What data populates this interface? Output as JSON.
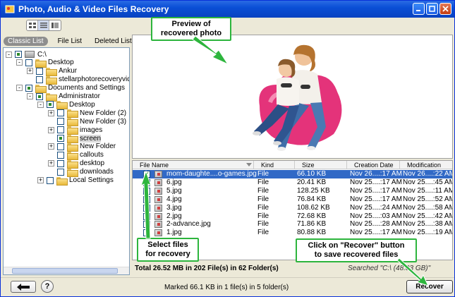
{
  "window": {
    "title": "Photo, Audio & Video Files Recovery",
    "controls": [
      "minimize-icon",
      "maximize-icon",
      "close-icon"
    ]
  },
  "tabs": [
    {
      "label": "Classic List",
      "active": true
    },
    {
      "label": "File List",
      "active": false
    },
    {
      "label": "Deleted List",
      "active": false
    }
  ],
  "tree": [
    {
      "label": "C:\\",
      "level": 0,
      "expander": "-",
      "check": "partial",
      "icon": "drive-icon"
    },
    {
      "label": "Desktop",
      "level": 1,
      "expander": "-",
      "check": "none",
      "icon": "folder-icon"
    },
    {
      "label": "Ankur",
      "level": 2,
      "expander": "+",
      "check": "none",
      "icon": "folder-icon"
    },
    {
      "label": "stellarphotorecoveryvideo",
      "level": 2,
      "expander": "",
      "check": "none",
      "icon": "folder-icon"
    },
    {
      "label": "Documents and Settings",
      "level": 1,
      "expander": "-",
      "check": "partial",
      "icon": "folder-icon"
    },
    {
      "label": "Administrator",
      "level": 2,
      "expander": "-",
      "check": "partial",
      "icon": "folder-icon"
    },
    {
      "label": "Desktop",
      "level": 3,
      "expander": "-",
      "check": "partial",
      "icon": "folder-icon"
    },
    {
      "label": "New Folder (2)",
      "level": 4,
      "expander": "+",
      "check": "none",
      "icon": "folder-icon"
    },
    {
      "label": "New Folder (3)",
      "level": 4,
      "expander": "",
      "check": "none",
      "icon": "folder-icon"
    },
    {
      "label": "images",
      "level": 4,
      "expander": "+",
      "check": "none",
      "icon": "folder-icon"
    },
    {
      "label": "screen",
      "level": 4,
      "expander": "",
      "check": "partial",
      "icon": "folder-icon",
      "selected": true
    },
    {
      "label": "New Folder",
      "level": 4,
      "expander": "+",
      "check": "none",
      "icon": "folder-icon"
    },
    {
      "label": "callouts",
      "level": 4,
      "expander": "",
      "check": "none",
      "icon": "folder-icon"
    },
    {
      "label": "desktop",
      "level": 4,
      "expander": "+",
      "check": "none",
      "icon": "folder-icon"
    },
    {
      "label": "downloads",
      "level": 4,
      "expander": "",
      "check": "none",
      "icon": "folder-icon"
    },
    {
      "label": "Local Settings",
      "level": 3,
      "expander": "+",
      "check": "none",
      "icon": "folder-icon"
    }
  ],
  "filelist": {
    "columns": [
      "File Name",
      "Kind",
      "Size",
      "Creation Date",
      "Modification Date"
    ],
    "rows": [
      {
        "name": "mom-daughte....o-games.jpg",
        "kind": "File",
        "size": "66.10 KB",
        "created": "Nov 26....:17 AM",
        "modified": "Nov 26....:22 AM",
        "checked": true,
        "selected": true
      },
      {
        "name": "6.jpg",
        "kind": "File",
        "size": "20.41 KB",
        "created": "Nov 25....:17 AM",
        "modified": "Nov 25....:45 AM",
        "checked": false,
        "selected": false
      },
      {
        "name": "5.jpg",
        "kind": "File",
        "size": "128.25 KB",
        "created": "Nov 25....:17 AM",
        "modified": "Nov 25....:11 AM",
        "checked": false,
        "selected": false
      },
      {
        "name": "4.jpg",
        "kind": "File",
        "size": "76.84 KB",
        "created": "Nov 25....:17 AM",
        "modified": "Nov 25....:52 AM",
        "checked": false,
        "selected": false
      },
      {
        "name": "3.jpg",
        "kind": "File",
        "size": "108.62 KB",
        "created": "Nov 25....:24 AM",
        "modified": "Nov 25....:58 AM",
        "checked": false,
        "selected": false
      },
      {
        "name": "2.jpg",
        "kind": "File",
        "size": "72.68 KB",
        "created": "Nov 25....:03 AM",
        "modified": "Nov 25....:42 AM",
        "checked": false,
        "selected": false
      },
      {
        "name": "2-advance.jpg",
        "kind": "File",
        "size": "71.86 KB",
        "created": "Nov 25....:28 AM",
        "modified": "Nov 25....:38 AM",
        "checked": false,
        "selected": false
      },
      {
        "name": "1.jpg",
        "kind": "File",
        "size": "80.88 KB",
        "created": "Nov 25....:17 AM",
        "modified": "Nov 25....:19 AM",
        "checked": false,
        "selected": false
      }
    ]
  },
  "status": {
    "total": "Total 26.52 MB in 202 File(s) in 62 Folder(s)",
    "search": "Searched \"C:\\ (48.83 GB)\""
  },
  "bottom": {
    "marked": "Marked 66.1 KB in 1 file(s) in 5 folder(s)",
    "recover_label": "Recover",
    "help_label": "?"
  },
  "callouts": {
    "preview": "Preview of\nrecovered photo",
    "select": "Select files\nfor recovery",
    "recover": "Click on \"Recover\" button\nto save recovered files"
  },
  "colors": {
    "titlebar": "#0a4fd6",
    "selection": "#3169c6",
    "callout_border": "#2db53d",
    "arrow": "#2db53d"
  }
}
